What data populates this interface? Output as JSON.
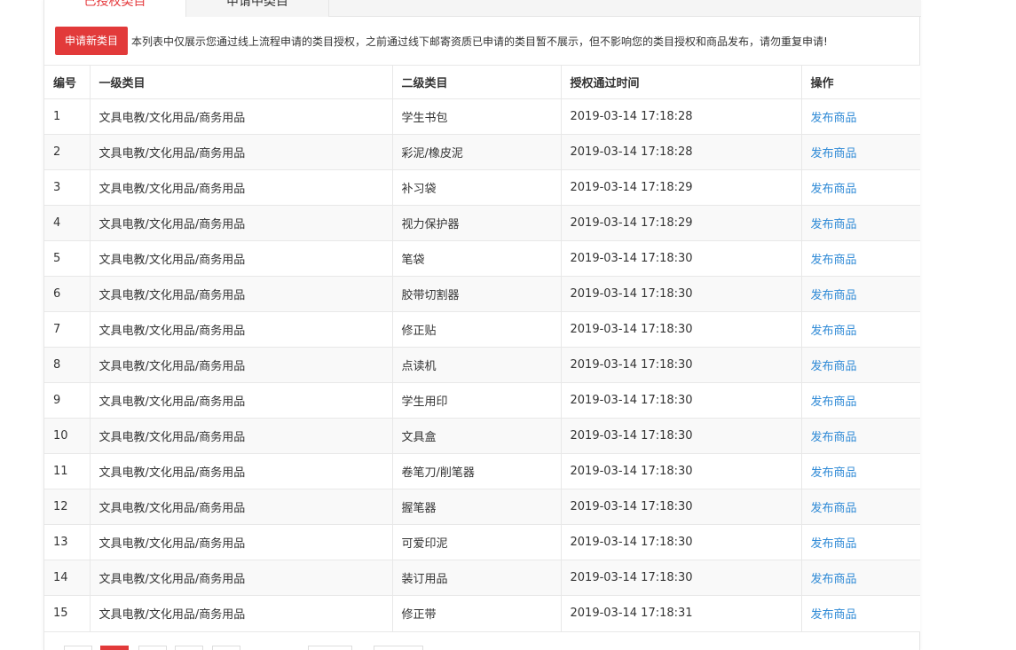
{
  "tabs": [
    {
      "label": "已授权类目"
    },
    {
      "label": "申请中类目"
    }
  ],
  "notice": {
    "button_label": "申请新类目",
    "text": "本列表中仅展示您通过线上流程申请的类目授权，之前通过线下邮寄资质已申请的类目暂不展示，但不影响您的类目授权和商品发布，请勿重复申请!"
  },
  "table": {
    "headers": [
      "编号",
      "一级类目",
      "二级类目",
      "授权通过时间",
      "操作"
    ],
    "rows": [
      {
        "id": "1",
        "cat1": "文具电教/文化用品/商务用品",
        "cat2": "学生书包",
        "time": "2019-03-14 17:18:28",
        "action": "发布商品"
      },
      {
        "id": "2",
        "cat1": "文具电教/文化用品/商务用品",
        "cat2": "彩泥/橡皮泥",
        "time": "2019-03-14 17:18:28",
        "action": "发布商品"
      },
      {
        "id": "3",
        "cat1": "文具电教/文化用品/商务用品",
        "cat2": "补习袋",
        "time": "2019-03-14 17:18:29",
        "action": "发布商品"
      },
      {
        "id": "4",
        "cat1": "文具电教/文化用品/商务用品",
        "cat2": "视力保护器",
        "time": "2019-03-14 17:18:29",
        "action": "发布商品"
      },
      {
        "id": "5",
        "cat1": "文具电教/文化用品/商务用品",
        "cat2": "笔袋",
        "time": "2019-03-14 17:18:30",
        "action": "发布商品"
      },
      {
        "id": "6",
        "cat1": "文具电教/文化用品/商务用品",
        "cat2": "胶带切割器",
        "time": "2019-03-14 17:18:30",
        "action": "发布商品"
      },
      {
        "id": "7",
        "cat1": "文具电教/文化用品/商务用品",
        "cat2": "修正贴",
        "time": "2019-03-14 17:18:30",
        "action": "发布商品"
      },
      {
        "id": "8",
        "cat1": "文具电教/文化用品/商务用品",
        "cat2": "点读机",
        "time": "2019-03-14 17:18:30",
        "action": "发布商品"
      },
      {
        "id": "9",
        "cat1": "文具电教/文化用品/商务用品",
        "cat2": "学生用印",
        "time": "2019-03-14 17:18:30",
        "action": "发布商品"
      },
      {
        "id": "10",
        "cat1": "文具电教/文化用品/商务用品",
        "cat2": "文具盒",
        "time": "2019-03-14 17:18:30",
        "action": "发布商品"
      },
      {
        "id": "11",
        "cat1": "文具电教/文化用品/商务用品",
        "cat2": "卷笔刀/削笔器",
        "time": "2019-03-14 17:18:30",
        "action": "发布商品"
      },
      {
        "id": "12",
        "cat1": "文具电教/文化用品/商务用品",
        "cat2": "握笔器",
        "time": "2019-03-14 17:18:30",
        "action": "发布商品"
      },
      {
        "id": "13",
        "cat1": "文具电教/文化用品/商务用品",
        "cat2": "可爱印泥",
        "time": "2019-03-14 17:18:30",
        "action": "发布商品"
      },
      {
        "id": "14",
        "cat1": "文具电教/文化用品/商务用品",
        "cat2": "装订用品",
        "time": "2019-03-14 17:18:30",
        "action": "发布商品"
      },
      {
        "id": "15",
        "cat1": "文具电教/文化用品/商务用品",
        "cat2": "修正带",
        "time": "2019-03-14 17:18:31",
        "action": "发布商品"
      }
    ]
  },
  "colors": {
    "accent": "#e23a3a",
    "link": "#2f8ad6",
    "row_alt": "#f9f9f9",
    "border": "#e8e8e8"
  }
}
